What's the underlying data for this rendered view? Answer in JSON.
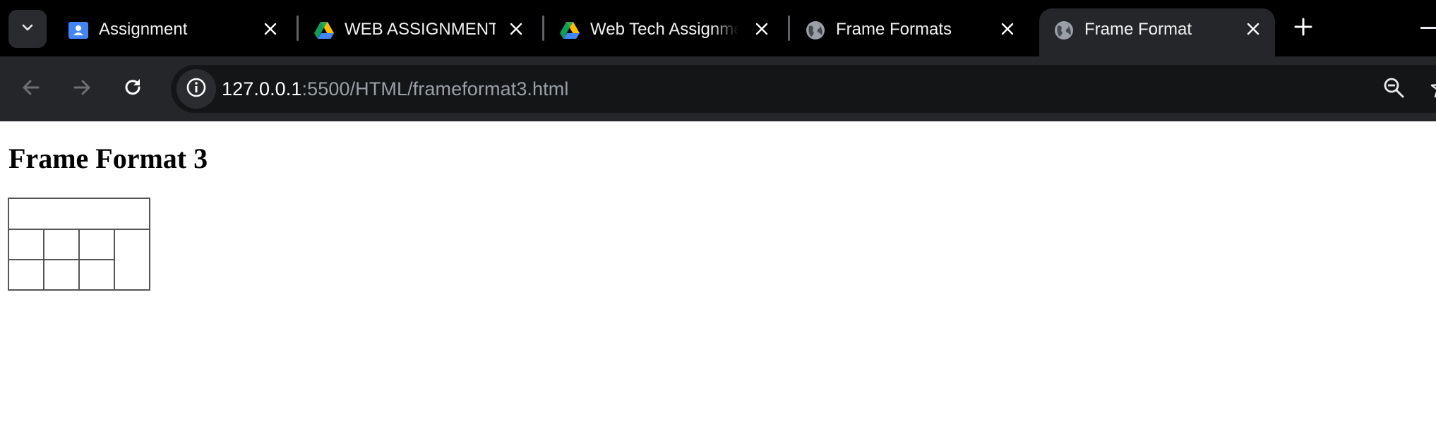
{
  "browser": {
    "tabs": [
      {
        "title": "Assignment",
        "icon": "google-classroom-icon",
        "active": false
      },
      {
        "title": "WEB ASSIGNMENT",
        "icon": "google-drive-icon",
        "active": false
      },
      {
        "title": "Web Tech Assignme",
        "icon": "google-drive-icon",
        "active": false
      },
      {
        "title": "Frame Formats",
        "icon": "globe-icon",
        "active": false
      },
      {
        "title": "Frame Format",
        "icon": "globe-icon",
        "active": true
      }
    ],
    "address_bar": {
      "host": "127.0.0.1",
      "path": ":5500/HTML/frameformat3.html"
    }
  },
  "page": {
    "title": "Frame Format 3"
  },
  "colors": {
    "tabstrip_bg": "#000000",
    "toolbar_bg": "#252629",
    "omnibox_bg": "#141517",
    "frame_border": "#555555"
  }
}
